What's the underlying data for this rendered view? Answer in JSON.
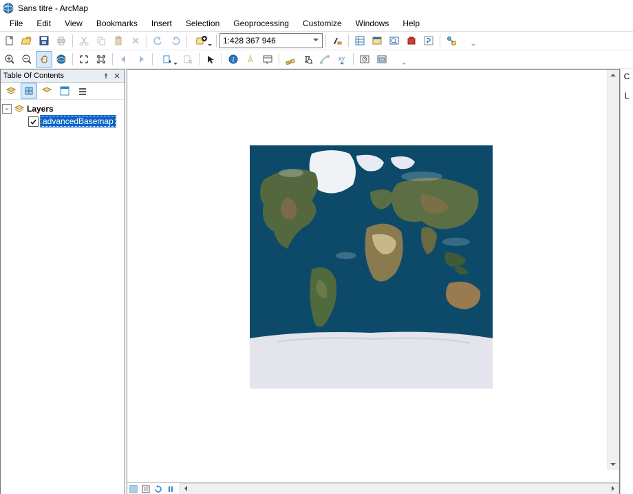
{
  "window": {
    "title": "Sans titre - ArcMap"
  },
  "menus": [
    "File",
    "Edit",
    "View",
    "Bookmarks",
    "Insert",
    "Selection",
    "Geoprocessing",
    "Customize",
    "Windows",
    "Help"
  ],
  "scale": "1:428 367 946",
  "toc": {
    "title": "Table Of Contents",
    "root_label": "Layers",
    "layer_label": "advancedBasemap",
    "layer_checked": true,
    "layer_selected": true
  },
  "right_tabs": [
    "C",
    "L"
  ],
  "colors": {
    "selection": "#0a64c8",
    "ocean": "#0d4a6a",
    "land": "#4a6640",
    "ice": "#e8e8f0"
  }
}
